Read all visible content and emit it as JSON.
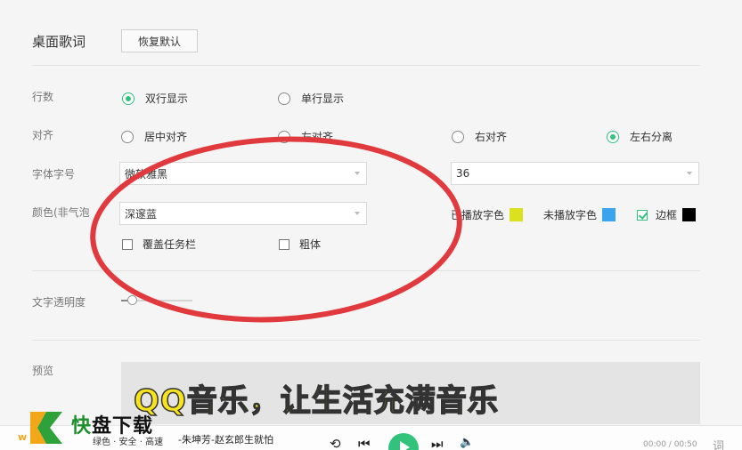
{
  "section_title": "桌面歌词",
  "reset_button": "恢复默认",
  "rows": {
    "lines_label": "行数",
    "align_label": "对齐",
    "font_label": "字体字号",
    "color_label": "颜色(非气泡",
    "opacity_label": "文字透明度",
    "preview_label": "预览"
  },
  "lines_options": [
    {
      "label": "双行显示",
      "checked": true
    },
    {
      "label": "单行显示",
      "checked": false
    }
  ],
  "align_options": [
    {
      "label": "居中对齐",
      "checked": false
    },
    {
      "label": "左对齐",
      "checked": false
    },
    {
      "label": "右对齐",
      "checked": false
    },
    {
      "label": "左右分离",
      "checked": true
    }
  ],
  "font": {
    "family": "微软雅黑",
    "size": "36"
  },
  "color": {
    "scheme": "深邃蓝",
    "played_label": "已播放字色",
    "played_color": "#dbe01f",
    "unplayed_label": "未播放字色",
    "unplayed_color": "#3aa4ee",
    "border_label": "边框",
    "border_checked": true,
    "border_color": "#000000"
  },
  "checkboxes": {
    "cover_taskbar": {
      "label": "覆盖任务栏",
      "checked": false
    },
    "bold": {
      "label": "粗体",
      "checked": false
    }
  },
  "opacity_value": 0.1,
  "preview": {
    "lyric_main": "QQ音乐，让生活充满音",
    "lyric_tail": "乐"
  },
  "player": {
    "song": "-朱坤芳-赵玄郎生就怕",
    "time": "00:00 / 00:50",
    "lyric_btn": "词"
  },
  "watermark": {
    "brand_k": "快",
    "brand_rest": "盘下载",
    "tagline": "绿色 · 安全 · 高速",
    "url_hint": "w"
  },
  "colors": {
    "accent": "#31c27c",
    "annotation": "#e03a3e"
  }
}
